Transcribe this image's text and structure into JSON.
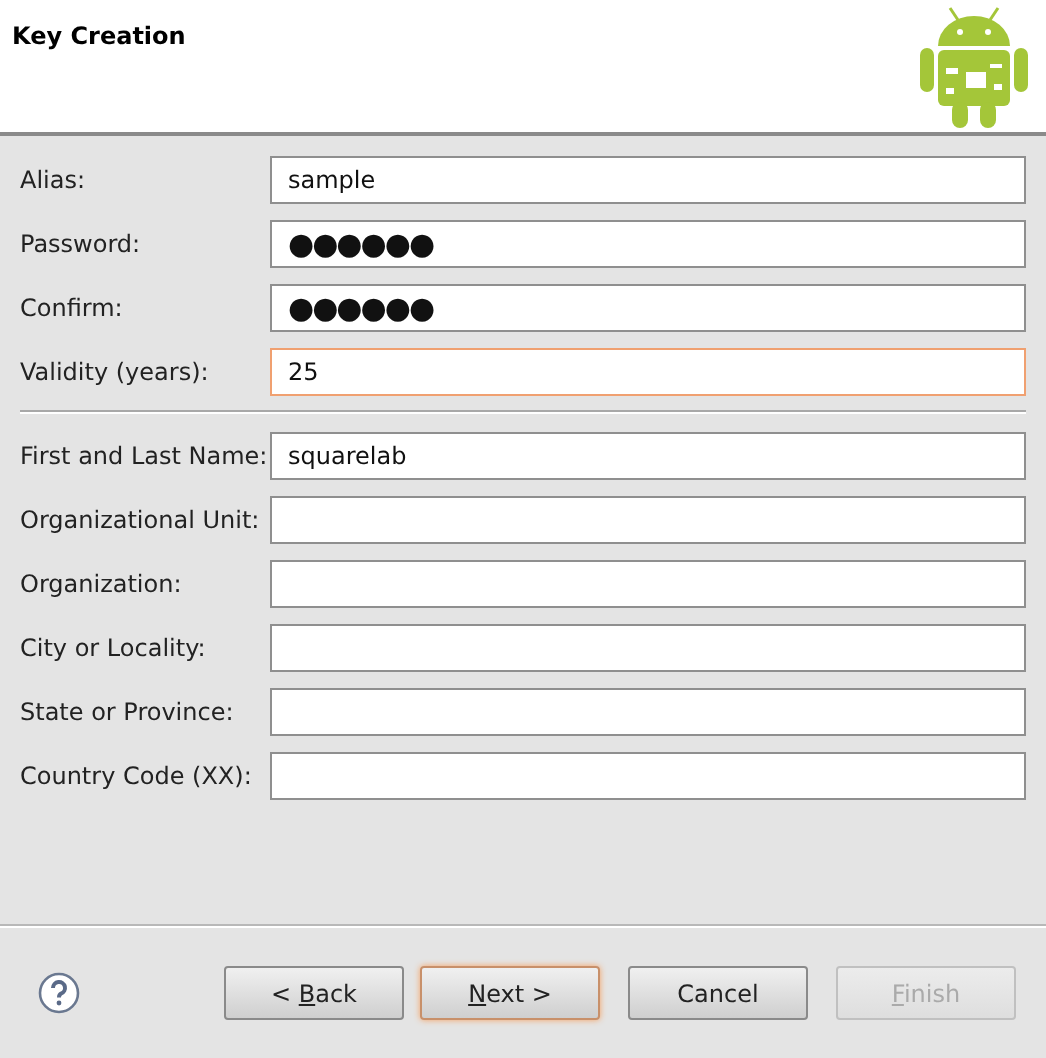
{
  "window": {
    "title": "Key Creation"
  },
  "groups": [
    {
      "fields": [
        {
          "label": "Alias:",
          "value": "sample",
          "kind": "text",
          "focused": false
        },
        {
          "label": "Password:",
          "value": "●●●●●●",
          "kind": "password",
          "focused": false
        },
        {
          "label": "Confirm:",
          "value": "●●●●●●",
          "kind": "password",
          "focused": false
        },
        {
          "label": "Validity (years):",
          "value": "25",
          "kind": "text",
          "focused": true
        }
      ]
    },
    {
      "fields": [
        {
          "label": "First and Last Name:",
          "value": "squarelab",
          "kind": "text",
          "focused": false
        },
        {
          "label": "Organizational Unit:",
          "kind": "text",
          "focused": false
        },
        {
          "label": "Organization:",
          "kind": "text",
          "focused": false
        },
        {
          "label": "City or Locality:",
          "kind": "text",
          "focused": false
        },
        {
          "label": "State or Province:",
          "kind": "text",
          "focused": false
        },
        {
          "label": "Country Code (XX):",
          "kind": "text",
          "focused": false
        }
      ]
    }
  ],
  "buttons": [
    {
      "before": "< ",
      "key": "B",
      "after": "ack",
      "disabled": false,
      "default": false
    },
    {
      "key": "N",
      "after": "ext >",
      "disabled": false,
      "default": true
    },
    {
      "before": "Cancel",
      "disabled": false,
      "default": false
    },
    {
      "key": "F",
      "after": "inish",
      "disabled": true,
      "default": false
    }
  ]
}
